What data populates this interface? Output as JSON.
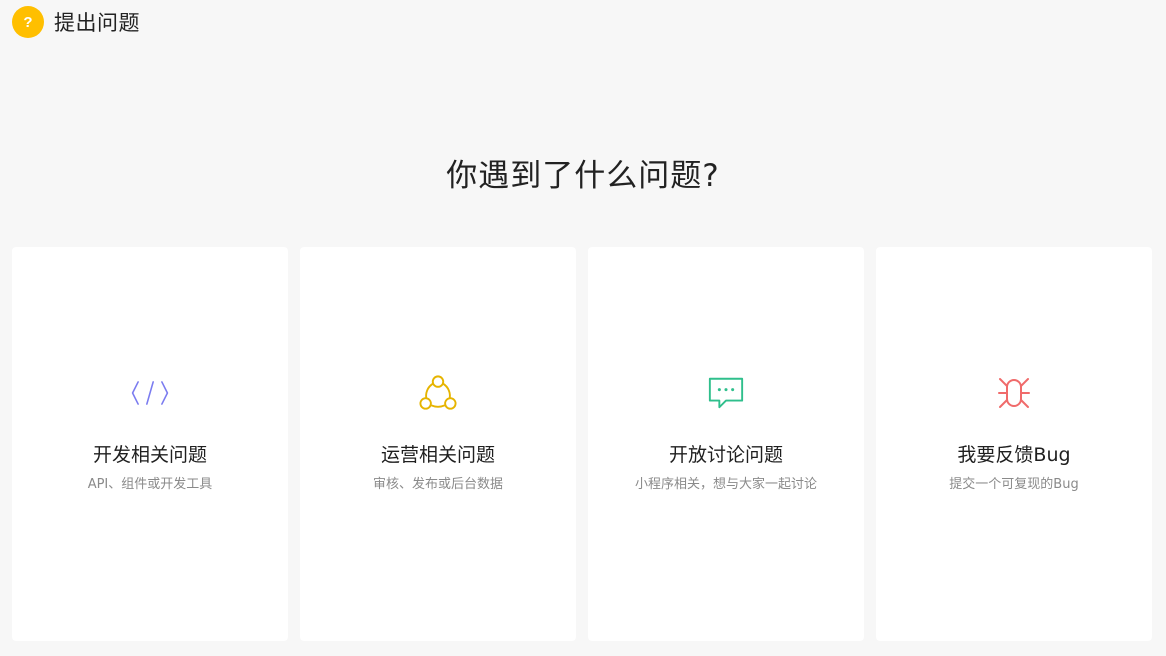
{
  "header": {
    "badge_glyph": "?",
    "badge_icon": "question-icon",
    "title": "提出问题"
  },
  "main": {
    "heading": "你遇到了什么问题?"
  },
  "cards": [
    {
      "title": "开发相关问题",
      "desc": "API、组件或开发工具",
      "icon": "code-icon",
      "color": "#7b7cf0"
    },
    {
      "title": "运营相关问题",
      "desc": "审核、发布或后台数据",
      "icon": "network-icon",
      "color": "#e6b400"
    },
    {
      "title": "开放讨论问题",
      "desc": "小程序相关，想与大家一起讨论",
      "icon": "chat-icon",
      "color": "#2fbf8c"
    },
    {
      "title": "我要反馈Bug",
      "desc": "提交一个可复现的Bug",
      "icon": "bug-icon",
      "color": "#f06b6b"
    }
  ],
  "colors": {
    "accent": "#ffbf00",
    "background": "#f7f7f7",
    "card_background": "#ffffff"
  }
}
